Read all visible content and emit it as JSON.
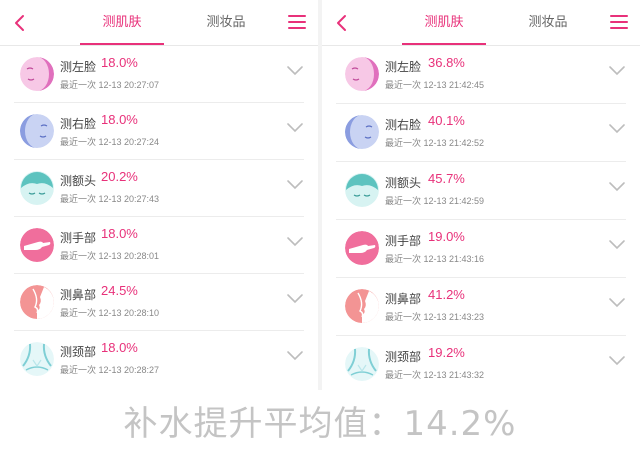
{
  "colors": {
    "accent": "#e8317a",
    "summary_text": "#c4c4c4"
  },
  "left": {
    "tabs": [
      {
        "label": "测肌肤"
      },
      {
        "label": "测妆品"
      }
    ],
    "items": [
      {
        "name": "测左脸",
        "value": "18.0%",
        "time": "最近一次 12-13 20:27:07",
        "icon": "left-face-icon"
      },
      {
        "name": "测右脸",
        "value": "18.0%",
        "time": "最近一次 12-13 20:27:24",
        "icon": "right-face-icon"
      },
      {
        "name": "测额头",
        "value": "20.2%",
        "time": "最近一次 12-13 20:27:43",
        "icon": "forehead-icon"
      },
      {
        "name": "测手部",
        "value": "18.0%",
        "time": "最近一次 12-13 20:28:01",
        "icon": "hand-icon"
      },
      {
        "name": "测鼻部",
        "value": "24.5%",
        "time": "最近一次 12-13 20:28:10",
        "icon": "nose-icon"
      },
      {
        "name": "测颈部",
        "value": "18.0%",
        "time": "最近一次 12-13 20:28:27",
        "icon": "neck-icon"
      }
    ]
  },
  "right": {
    "tabs": [
      {
        "label": "测肌肤"
      },
      {
        "label": "测妆品"
      }
    ],
    "items": [
      {
        "name": "测左脸",
        "value": "36.8%",
        "time": "最近一次 12-13 21:42:45",
        "icon": "left-face-icon"
      },
      {
        "name": "测右脸",
        "value": "40.1%",
        "time": "最近一次 12-13 21:42:52",
        "icon": "right-face-icon"
      },
      {
        "name": "测额头",
        "value": "45.7%",
        "time": "最近一次 12-13 21:42:59",
        "icon": "forehead-icon"
      },
      {
        "name": "测手部",
        "value": "19.0%",
        "time": "最近一次 12-13 21:43:16",
        "icon": "hand-icon"
      },
      {
        "name": "测鼻部",
        "value": "41.2%",
        "time": "最近一次 12-13 21:43:23",
        "icon": "nose-icon"
      },
      {
        "name": "测颈部",
        "value": "19.2%",
        "time": "最近一次 12-13 21:43:32",
        "icon": "neck-icon"
      }
    ]
  },
  "summary": "补水提升平均值：14.2%"
}
